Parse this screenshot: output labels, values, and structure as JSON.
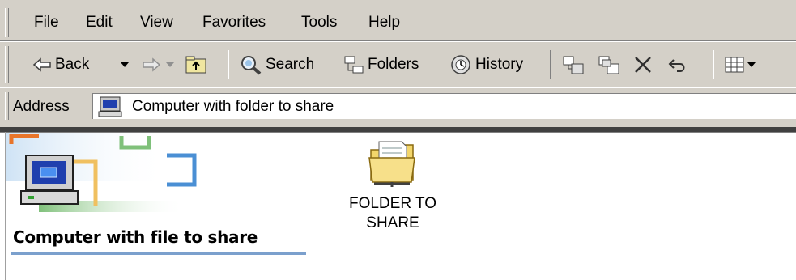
{
  "menu": {
    "items": [
      "File",
      "Edit",
      "View",
      "Favorites",
      "Tools",
      "Help"
    ]
  },
  "toolbar": {
    "back_label": "Back",
    "search_label": "Search",
    "folders_label": "Folders",
    "history_label": "History"
  },
  "address": {
    "label": "Address",
    "value": "Computer with folder to share"
  },
  "panel": {
    "title": "Computer with file to share"
  },
  "folder": {
    "label_line1": "FOLDER TO",
    "label_line2": "SHARE"
  },
  "colors": {
    "chrome": "#d4d0c8",
    "panel_rule": "#7ba0cd",
    "folder_yellow": "#f3d66b"
  }
}
